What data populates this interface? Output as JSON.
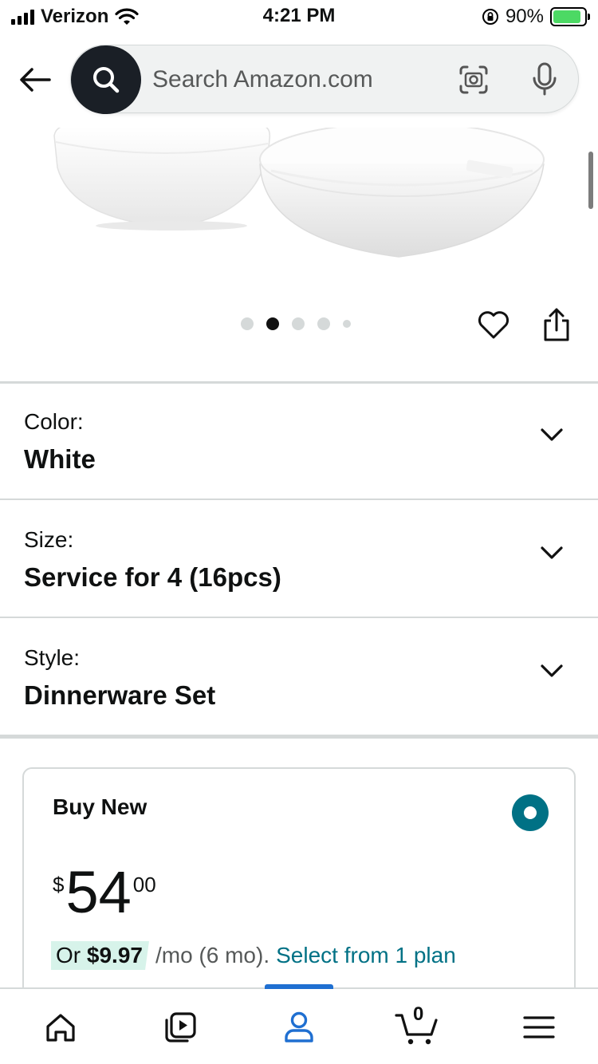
{
  "status_bar": {
    "carrier": "Verizon",
    "time": "4:21 PM",
    "battery_percent": "90%"
  },
  "search": {
    "placeholder": "Search Amazon.com"
  },
  "product": {
    "image_alt": "White dinnerware bowls",
    "carousel": {
      "total": 5,
      "active_index": 1
    }
  },
  "variations": [
    {
      "label": "Color:",
      "value": "White"
    },
    {
      "label": "Size:",
      "value": "Service for 4 (16pcs)"
    },
    {
      "label": "Style:",
      "value": "Dinnerware Set"
    }
  ],
  "buy_box": {
    "title": "Buy New",
    "price_symbol": "$",
    "price_whole": "54",
    "price_fraction": "00",
    "installment_prefix": "Or",
    "installment_amount": "$9.97",
    "installment_term": "/mo (6 mo).",
    "installment_link": "Select from 1 plan"
  },
  "bottom_nav": {
    "cart_count": "0",
    "items": [
      "home-icon",
      "video-icon",
      "account-icon",
      "cart-icon",
      "menu-icon"
    ]
  },
  "colors": {
    "accent_teal": "#007185",
    "nav_active_blue": "#1f6fd1",
    "installment_badge": "#d7f3ea",
    "search_button": "#1a1f26"
  }
}
